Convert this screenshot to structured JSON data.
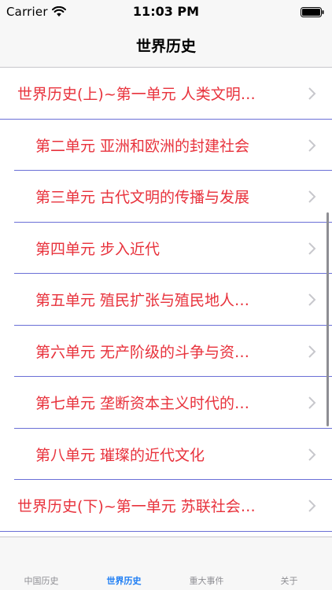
{
  "status": {
    "carrier": "Carrier",
    "time": "11:03 PM"
  },
  "nav": {
    "title": "世界历史"
  },
  "list": [
    {
      "label": "世界历史(上)~第一单元 人类文明…",
      "sub": false
    },
    {
      "label": "第二单元 亚洲和欧洲的封建社会",
      "sub": true
    },
    {
      "label": "第三单元 古代文明的传播与发展",
      "sub": true
    },
    {
      "label": "第四单元 步入近代",
      "sub": true
    },
    {
      "label": "第五单元 殖民扩张与殖民地人…",
      "sub": true
    },
    {
      "label": "第六单元 无产阶级的斗争与资…",
      "sub": true
    },
    {
      "label": "第七单元 垄断资本主义时代的…",
      "sub": true
    },
    {
      "label": "第八单元 璀璨的近代文化",
      "sub": true
    },
    {
      "label": "世界历史(下)~第一单元 苏联社会…",
      "sub": false
    }
  ],
  "tabs": [
    {
      "label": "中国历史",
      "active": false
    },
    {
      "label": "世界历史",
      "active": true
    },
    {
      "label": "重大事件",
      "active": false
    },
    {
      "label": "关于",
      "active": false
    }
  ],
  "colors": {
    "item_text": "#e8323c",
    "separator": "#6a6fd6",
    "tab_active": "#1b7cf4",
    "tab_inactive": "#8e8e93"
  }
}
